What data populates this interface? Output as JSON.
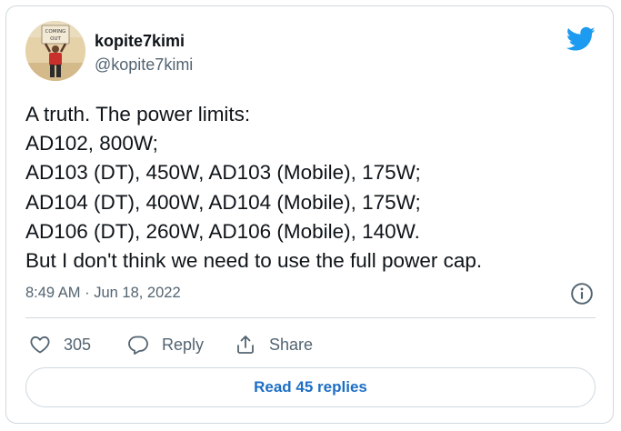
{
  "author": {
    "display_name": "kopite7kimi",
    "handle": "@kopite7kimi",
    "avatar_icon": "person-holding-sign-avatar",
    "avatar_sign_text": "COMING OUT"
  },
  "logo_icon": "twitter-bird-icon",
  "tweet": {
    "lines": [
      "A truth. The power limits:",
      "AD102, 800W;",
      "AD103 (DT), 450W, AD103 (Mobile), 175W;",
      "AD104 (DT), 400W, AD104 (Mobile), 175W;",
      "AD106 (DT), 260W, AD106 (Mobile), 140W.",
      "But I don't think we need to use the full power cap."
    ],
    "timestamp": "8:49 AM · Jun 18, 2022"
  },
  "actions": {
    "like_count": "305",
    "reply_label": "Reply",
    "share_label": "Share"
  },
  "read_replies_label": "Read 45 replies",
  "colors": {
    "brand_blue": "#1d9bf0",
    "link_blue": "#1d6fc4",
    "text_primary": "#0f1419",
    "text_secondary": "#536471",
    "border": "#cfd9de"
  }
}
